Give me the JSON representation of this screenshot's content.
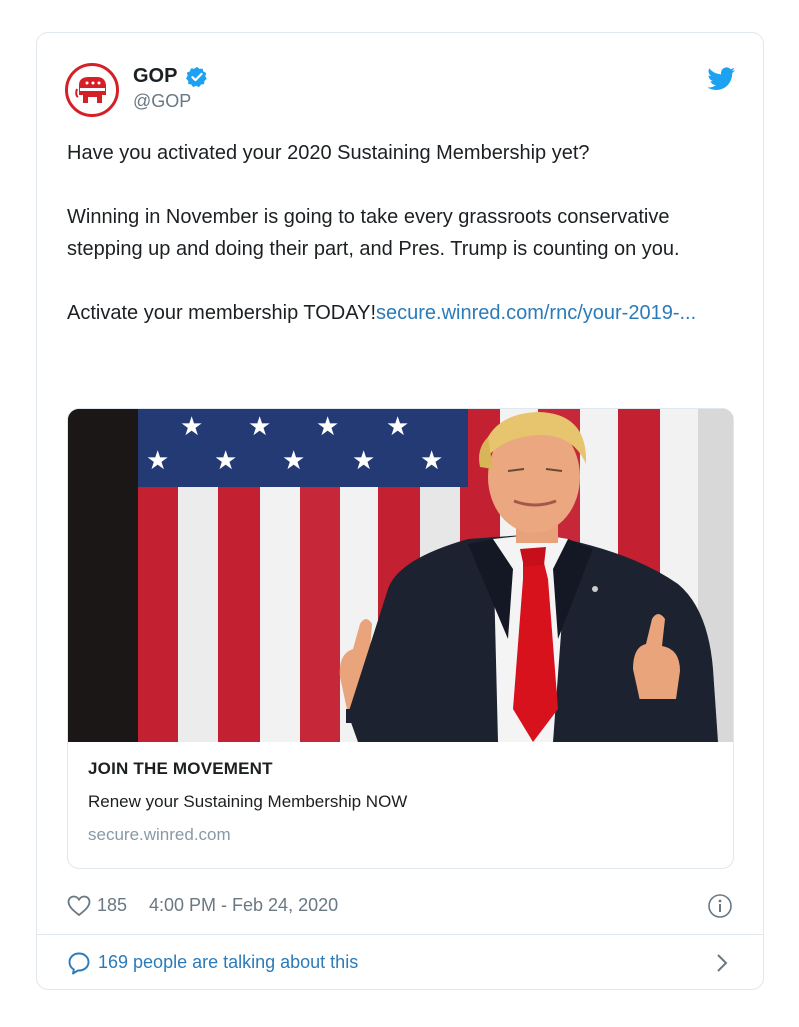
{
  "account": {
    "name": "GOP",
    "handle": "@GOP",
    "avatar_icon": "republican-elephant-icon",
    "brand_color": "#d52027",
    "verified": true
  },
  "tweet": {
    "line1": "Have you activated your 2020 Sustaining Membership yet?",
    "line2": "Winning in November is going to take every grassroots conservative stepping up and doing their part, and Pres. Trump is counting on you.",
    "line3_text": "Activate your membership TODAY!",
    "line3_link": "secure.winred.com/rnc/your-2019-..."
  },
  "card": {
    "title": "JOIN THE MOVEMENT",
    "description": "Renew your Sustaining Membership NOW",
    "domain": "secure.winred.com",
    "photo_alt": "Man in suit and red tie giving thumbs up in front of American flag"
  },
  "meta": {
    "likes": "185",
    "timestamp": "4:00 PM - Feb 24, 2020"
  },
  "footer": {
    "talking": "169 people are talking about this"
  },
  "colors": {
    "link": "#2b7bb9",
    "muted": "#697882",
    "twitter_blue": "#1da1f2"
  }
}
